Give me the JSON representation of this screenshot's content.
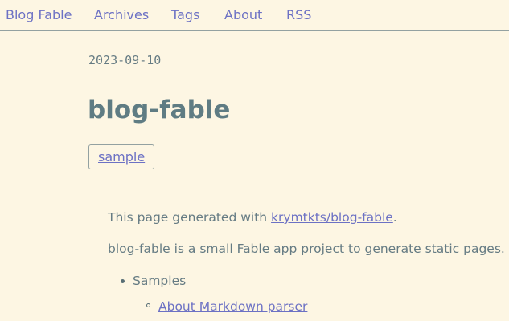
{
  "nav": {
    "home": "Blog Fable",
    "archives": "Archives",
    "tags": "Tags",
    "about": "About",
    "rss": "RSS"
  },
  "post": {
    "date": "2023-09-10",
    "title": "blog-fable",
    "tag": "sample",
    "intro_prefix": "This page generated with ",
    "intro_link": "krymtkts/blog-fable",
    "intro_suffix": ".",
    "description": "blog-fable is a small Fable app project to generate static pages.",
    "list": {
      "item": "Samples",
      "subitem_link": "About Markdown parser"
    }
  },
  "colors": {
    "background": "#fdf6e3",
    "link": "#6c71c4",
    "text": "#657b83",
    "title": "#5f7c83"
  }
}
